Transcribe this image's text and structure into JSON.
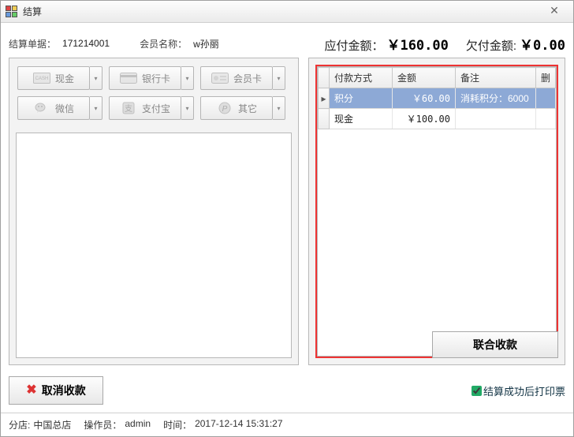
{
  "window": {
    "title": "结算"
  },
  "header": {
    "order_label": "结算单据：",
    "order_no": "171214001",
    "member_label": "会员名称：",
    "member_name": "w孙丽",
    "payable_label": "应付金额：",
    "payable_value": "￥160.00",
    "due_label": "欠付金额:",
    "due_value": "￥0.00"
  },
  "pay_methods": {
    "cash": "现金",
    "card": "银行卡",
    "member": "会员卡",
    "wechat": "微信",
    "alipay": "支付宝",
    "other": "其它"
  },
  "grid": {
    "columns": {
      "method": "付款方式",
      "amount": "金额",
      "remark": "备注",
      "del": "删"
    },
    "rows": [
      {
        "selected": true,
        "method": "积分",
        "amount": "￥60.00",
        "remark": "消耗积分：6000"
      },
      {
        "selected": false,
        "method": "现金",
        "amount": "￥100.00",
        "remark": ""
      }
    ]
  },
  "actions": {
    "combine": "联合收款",
    "cancel": "取消收款",
    "print_label": "结算成功后打印票"
  },
  "status": {
    "branch_label": "分店:",
    "branch": "中国总店",
    "operator_label": "操作员：",
    "operator": "admin",
    "time_label": "时间：",
    "time": "2017-12-14 15:31:27"
  }
}
